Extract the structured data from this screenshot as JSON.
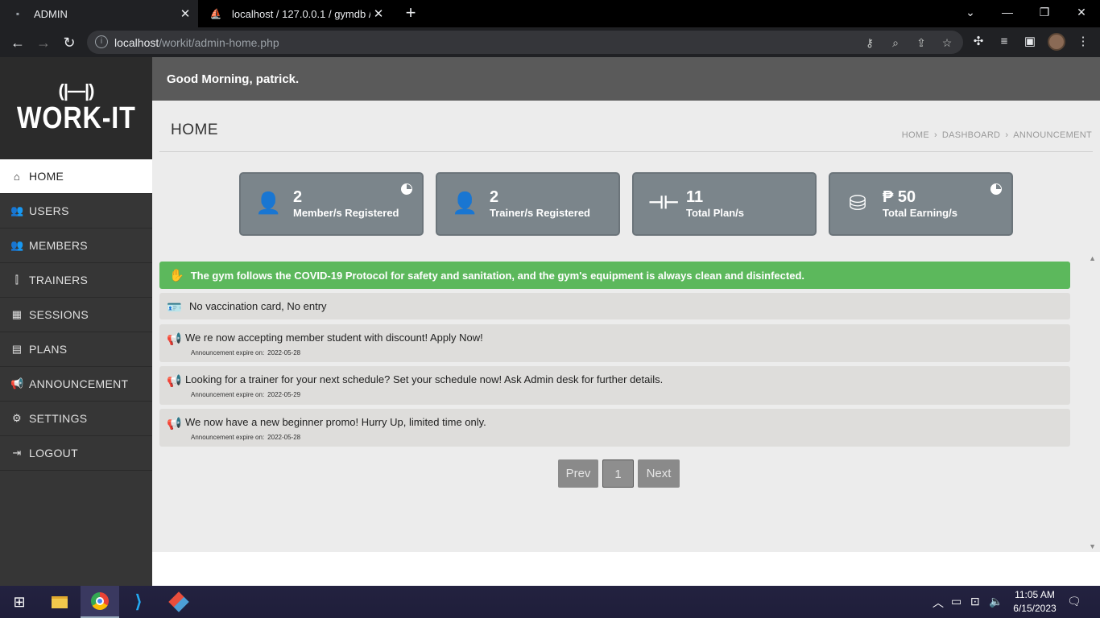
{
  "browser": {
    "tabs": [
      {
        "title": "ADMIN",
        "active": true
      },
      {
        "title": "localhost / 127.0.0.1 / gymdb / g",
        "active": false
      }
    ],
    "url_host": "localhost",
    "url_path": "/workit/admin-home.php"
  },
  "sidebar": {
    "logo_text": "WORK-IT",
    "items": [
      {
        "label": "HOME",
        "icon": "home-icon",
        "active": true
      },
      {
        "label": "USERS",
        "icon": "users-icon"
      },
      {
        "label": "MEMBERS",
        "icon": "members-icon"
      },
      {
        "label": "TRAINERS",
        "icon": "dumbbell-icon"
      },
      {
        "label": "SESSIONS",
        "icon": "calendar-icon"
      },
      {
        "label": "PLANS",
        "icon": "file-icon"
      },
      {
        "label": "ANNOUNCEMENT",
        "icon": "megaphone-icon"
      },
      {
        "label": "SETTINGS",
        "icon": "gear-icon"
      },
      {
        "label": "LOGOUT",
        "icon": "logout-icon"
      }
    ]
  },
  "header": {
    "greeting": "Good Morning, patrick."
  },
  "page": {
    "title": "HOME",
    "breadcrumb": [
      "HOME",
      "DASHBOARD",
      "ANNOUNCEMENT"
    ]
  },
  "cards": [
    {
      "value": "2",
      "label": "Member/s Registered",
      "icon": "user-icon"
    },
    {
      "value": "2",
      "label": "Trainer/s Registered",
      "icon": "user-icon"
    },
    {
      "value": "11",
      "label": "Total Plan/s",
      "icon": "dumbbell-icon"
    },
    {
      "value": "₱ 50",
      "label": "Total Earning/s",
      "icon": "coins-icon"
    }
  ],
  "banner": "The gym follows the COVID-19 Protocol for safety and sanitation, and the gym's equipment is always clean and disinfected.",
  "notice": "No vaccination card, No entry",
  "announcements": [
    {
      "text": "We re now accepting member student with discount! Apply Now!",
      "expire_label": "Announcement expire on:",
      "expire_date": "2022-05-28"
    },
    {
      "text": "Looking for a trainer for your next schedule? Set your schedule now! Ask Admin desk for further details.",
      "expire_label": "Announcement expire on:",
      "expire_date": "2022-05-29"
    },
    {
      "text": "We now have a new beginner promo! Hurry Up, limited time only.",
      "expire_label": "Announcement expire on:",
      "expire_date": "2022-05-28"
    }
  ],
  "pagination": {
    "prev": "Prev",
    "page": "1",
    "next": "Next"
  },
  "taskbar": {
    "time": "11:05 AM",
    "date": "6/15/2023"
  }
}
